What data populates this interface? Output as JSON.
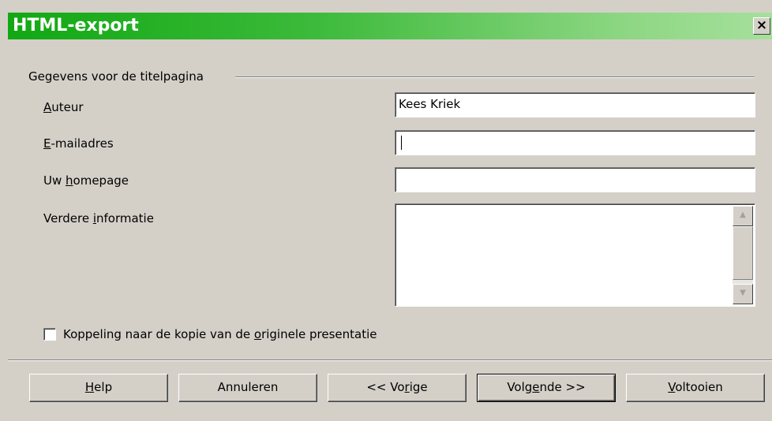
{
  "window": {
    "title": "HTML-export",
    "close_glyph": "×"
  },
  "group": {
    "label": "Gegevens voor de titelpagina"
  },
  "fields": {
    "author": {
      "label_pre": "",
      "label_accel": "A",
      "label_post": "uteur",
      "value": "Kees Kriek"
    },
    "email": {
      "label_pre": "",
      "label_accel": "E",
      "label_post": "-mailadres",
      "value": ""
    },
    "homepage": {
      "label_pre": "Uw ",
      "label_accel": "h",
      "label_post": "omepage",
      "value": ""
    },
    "info": {
      "label_pre": "Verdere ",
      "label_accel": "i",
      "label_post": "nformatie",
      "value": ""
    }
  },
  "checkbox": {
    "label_pre": "Koppeling naar de kopie van de ",
    "label_accel": "o",
    "label_post": "riginele presentatie",
    "checked": false
  },
  "buttons": {
    "help": {
      "pre": "",
      "accel": "H",
      "post": "elp"
    },
    "cancel": {
      "pre": "Annuleren",
      "accel": "",
      "post": ""
    },
    "previous": {
      "pre": "<< Vo",
      "accel": "r",
      "post": "ige"
    },
    "next": {
      "pre": "Volg",
      "accel": "e",
      "post": "nde >>"
    },
    "finish": {
      "pre": "",
      "accel": "V",
      "post": "oltooien"
    }
  },
  "icons": {
    "scroll_up": "▲",
    "scroll_down": "▼"
  }
}
